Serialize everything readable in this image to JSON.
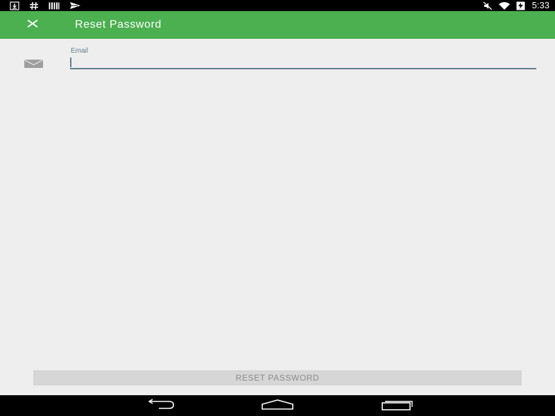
{
  "status_bar": {
    "left_icons": [
      "download-icon",
      "hash-icon",
      "barcode-icon",
      "send-icon"
    ],
    "right_icons": [
      "mute-icon",
      "wifi-icon",
      "battery-charging-icon"
    ],
    "time": "5:33"
  },
  "app_bar": {
    "close_icon": "close-icon",
    "title": "Reset Password",
    "color": "#4CAF50"
  },
  "form": {
    "email": {
      "icon": "mail-icon",
      "label": "Email",
      "value": "",
      "placeholder": ""
    }
  },
  "actions": {
    "reset_label": "RESET PASSWORD"
  },
  "nav_bar": {
    "buttons": [
      "back-icon",
      "home-icon",
      "recents-icon"
    ]
  }
}
